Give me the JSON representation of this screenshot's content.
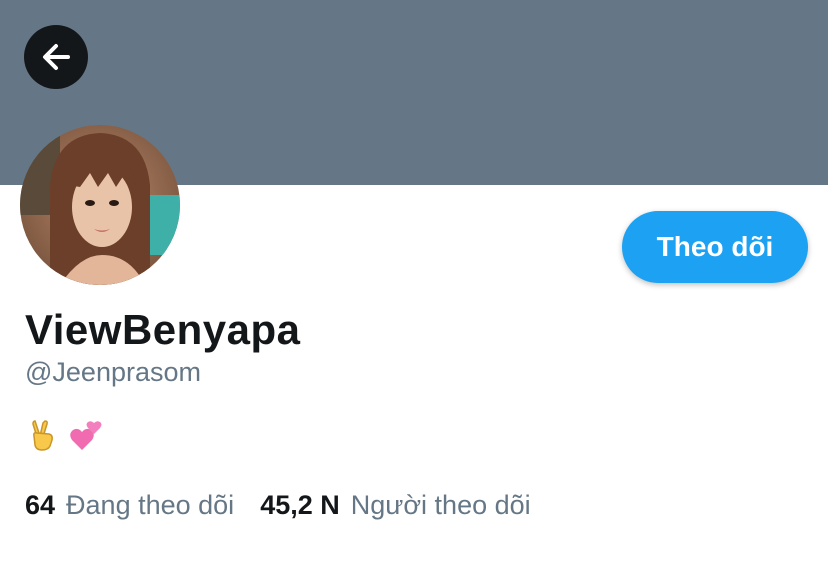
{
  "header": {
    "back_icon": "arrow-left-icon",
    "banner_color": "#657786"
  },
  "profile": {
    "avatar": "profile-photo",
    "display_name": "ViewBenyapa",
    "handle": "@Jeenprasom",
    "bio_icons": [
      "victory-hand-emoji",
      "two-hearts-emoji"
    ],
    "follow_label": "Theo dõi",
    "accent_color": "#1da1f2"
  },
  "stats": {
    "following_count": "64",
    "following_label": "Đang theo dõi",
    "followers_count": "45,2 N",
    "followers_label": "Người theo dõi"
  }
}
